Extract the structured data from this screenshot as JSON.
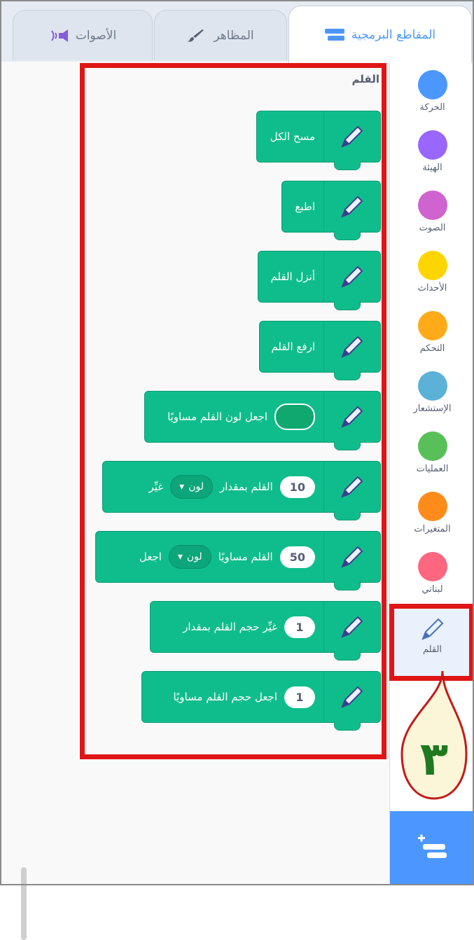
{
  "tabs": [
    {
      "label": "المقاطع البرمجية",
      "icon": "code-icon",
      "active": true
    },
    {
      "label": "المظاهر",
      "icon": "brush-icon",
      "active": false
    },
    {
      "label": "الأصوات",
      "icon": "speaker-icon",
      "active": false
    }
  ],
  "categories": [
    {
      "label": "الحركة",
      "color": "#4c97ff"
    },
    {
      "label": "الهيئة",
      "color": "#9966ff"
    },
    {
      "label": "الصوت",
      "color": "#cf63cf"
    },
    {
      "label": "الأحداث",
      "color": "#ffd500"
    },
    {
      "label": "التحكم",
      "color": "#ffab19"
    },
    {
      "label": "الإستشعار",
      "color": "#5cb1d6"
    },
    {
      "label": "العمليات",
      "color": "#59c059"
    },
    {
      "label": "المتغيرات",
      "color": "#ff8c1a"
    },
    {
      "label": "لبناتي",
      "color": "#ff6680"
    },
    {
      "label": "القلم",
      "color": "#0fbd8c",
      "icon": "pen-icon",
      "selected": true
    }
  ],
  "palette": {
    "title": "القلم",
    "blocks": {
      "clear": "مسح الكل",
      "stamp": "اطبع",
      "pen_down": "أنزل القلم",
      "pen_up": "ارفع القلم",
      "set_color": "اجعل لون القلم مساويًا",
      "change_param": {
        "verb": "غيِّر",
        "dropdown": "لون",
        "suffix": "القلم بمقدار",
        "value": "10"
      },
      "set_param": {
        "verb": "اجعل",
        "dropdown": "لون",
        "suffix": "القلم مساويًا",
        "value": "50"
      },
      "change_size": {
        "text": "غيِّر حجم القلم بمقدار",
        "value": "1"
      },
      "set_size": {
        "text": "اجعل حجم القلم مساويًا",
        "value": "1"
      }
    }
  },
  "annotation": {
    "label": "٣",
    "color": "#e01515",
    "fill": "#fbf6d7",
    "numeral_color": "#1f7a1f"
  },
  "colors": {
    "pen_block": "#0fbd8c",
    "accent": "#4c97ff",
    "annotation_border": "#e01515"
  }
}
